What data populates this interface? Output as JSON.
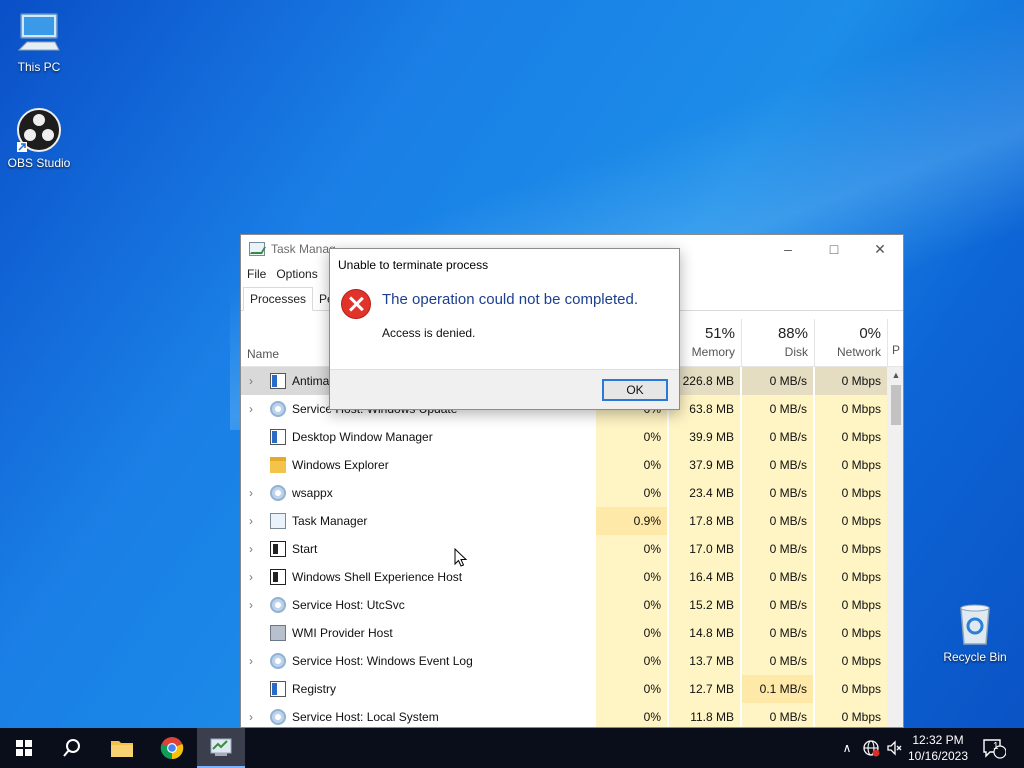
{
  "desktop": {
    "icons": [
      {
        "label": "This PC",
        "icon": "this-pc-icon"
      },
      {
        "label": "OBS Studio",
        "icon": "obs-studio-icon"
      },
      {
        "label": "Recycle Bin",
        "icon": "recycle-bin-icon"
      }
    ]
  },
  "task_manager": {
    "title": "Task Manag",
    "menu": [
      "File",
      "Options"
    ],
    "tabs": [
      "Processes",
      "Per"
    ],
    "columns": {
      "name": "Name",
      "memory": {
        "pct": "51%",
        "label": "Memory"
      },
      "disk": {
        "pct": "88%",
        "label": "Disk"
      },
      "network": {
        "pct": "0%",
        "label": "Network"
      },
      "power_partial": "P"
    },
    "rows": [
      {
        "name": "Antima",
        "cpu": "",
        "mem": "226.8 MB",
        "disk": "0 MB/s",
        "net": "0 Mbps",
        "icon": "win",
        "expand": true,
        "selected": true
      },
      {
        "name": "Service Host: Windows Update",
        "cpu": "0%",
        "mem": "63.8 MB",
        "disk": "0 MB/s",
        "net": "0 Mbps",
        "icon": "gear",
        "expand": true
      },
      {
        "name": "Desktop Window Manager",
        "cpu": "0%",
        "mem": "39.9 MB",
        "disk": "0 MB/s",
        "net": "0 Mbps",
        "icon": "win",
        "expand": false
      },
      {
        "name": "Windows Explorer",
        "cpu": "0%",
        "mem": "37.9 MB",
        "disk": "0 MB/s",
        "net": "0 Mbps",
        "icon": "folder",
        "expand": false
      },
      {
        "name": "wsappx",
        "cpu": "0%",
        "mem": "23.4 MB",
        "disk": "0 MB/s",
        "net": "0 Mbps",
        "icon": "gear",
        "expand": true
      },
      {
        "name": "Task Manager",
        "cpu": "0.9%",
        "mem": "17.8 MB",
        "disk": "0 MB/s",
        "net": "0 Mbps",
        "icon": "tm",
        "expand": true,
        "cpu_hot": true
      },
      {
        "name": "Start",
        "cpu": "0%",
        "mem": "17.0 MB",
        "disk": "0 MB/s",
        "net": "0 Mbps",
        "icon": "start",
        "expand": true
      },
      {
        "name": "Windows Shell Experience Host",
        "cpu": "0%",
        "mem": "16.4 MB",
        "disk": "0 MB/s",
        "net": "0 Mbps",
        "icon": "start",
        "expand": true
      },
      {
        "name": "Service Host: UtcSvc",
        "cpu": "0%",
        "mem": "15.2 MB",
        "disk": "0 MB/s",
        "net": "0 Mbps",
        "icon": "gear",
        "expand": true
      },
      {
        "name": "WMI Provider Host",
        "cpu": "0%",
        "mem": "14.8 MB",
        "disk": "0 MB/s",
        "net": "0 Mbps",
        "icon": "wmi",
        "expand": false
      },
      {
        "name": "Service Host: Windows Event Log",
        "cpu": "0%",
        "mem": "13.7 MB",
        "disk": "0 MB/s",
        "net": "0 Mbps",
        "icon": "gear",
        "expand": true
      },
      {
        "name": "Registry",
        "cpu": "0%",
        "mem": "12.7 MB",
        "disk": "0.1 MB/s",
        "net": "0 Mbps",
        "icon": "win",
        "expand": false,
        "disk_hot": true
      },
      {
        "name": "Service Host: Local System",
        "cpu": "0%",
        "mem": "11.8 MB",
        "disk": "0 MB/s",
        "net": "0 Mbps",
        "icon": "gear",
        "expand": true
      }
    ]
  },
  "dialog": {
    "title": "Unable to terminate process",
    "main": "The operation could not be completed.",
    "sub": "Access is denied.",
    "ok": "OK"
  },
  "taskbar": {
    "time": "12:32 PM",
    "date": "10/16/2023",
    "notification_count": "1"
  }
}
